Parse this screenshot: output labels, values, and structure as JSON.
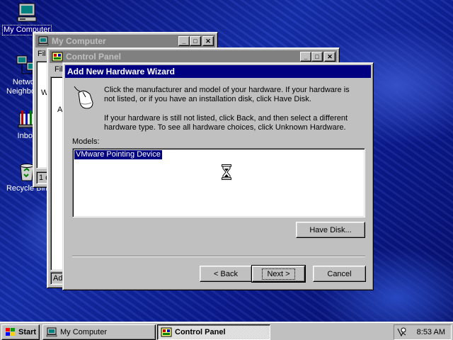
{
  "desktop": {
    "icons": [
      {
        "label": "My Computer"
      },
      {
        "label": "Network Neighborhood"
      },
      {
        "label": "Inbox"
      },
      {
        "label": "Recycle Bin"
      }
    ]
  },
  "my_computer_window": {
    "title": "My Computer",
    "menu_partial": "Fil",
    "status_partial": "1 o",
    "content_partial": "W"
  },
  "control_panel_window": {
    "title": "Control Panel",
    "menu_partial": "Fil",
    "content_partial": "A",
    "status_partial": "Add"
  },
  "wizard": {
    "title": "Add New Hardware Wizard",
    "intro_text": "Click the manufacturer and model of your hardware. If your hardware is not listed, or if you have an installation disk, click Have Disk.",
    "secondary_text": "If your hardware is still not listed, click Back, and then select a different hardware type. To see all hardware choices, click Unknown Hardware.",
    "models_label": "Models:",
    "models": [
      "VMware Pointing Device"
    ],
    "selected_model": "VMware Pointing Device",
    "have_disk_label": "Have Disk...",
    "back_label": "< Back",
    "next_label": "Next >",
    "cancel_label": "Cancel"
  },
  "taskbar": {
    "start_label": "Start",
    "tasks": [
      {
        "label": "My Computer",
        "pressed": false
      },
      {
        "label": "Control Panel",
        "pressed": true
      }
    ],
    "clock": "8:53 AM"
  },
  "colors": {
    "title_active": "#000080",
    "title_inactive": "#808080",
    "face": "#c0c0c0",
    "desktop": "#0a1a8c"
  }
}
